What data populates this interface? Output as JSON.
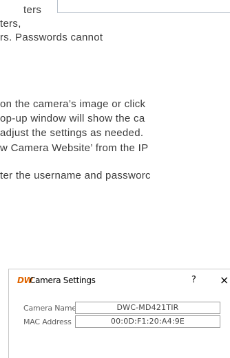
{
  "doc": {
    "line1": "ters",
    "line2": "ters,",
    "line3": "rs. Passwords cannot",
    "para1": "on the camera’s image or click",
    "para2": "op-up window will show the ca",
    "para3": "adjust the settings as needed.",
    "para4": "w Camera Website’ from the IP",
    "para5": "ter the username and passworc"
  },
  "dialog": {
    "logo": "DW",
    "title": "Camera Settings",
    "help": "?",
    "close": "×",
    "fields": {
      "camera_name_label": "Camera Name",
      "camera_name_value": "DWC-MD421TIR",
      "mac_label": "MAC Address",
      "mac_value": "00:0D:F1:20:A4:9E"
    }
  }
}
